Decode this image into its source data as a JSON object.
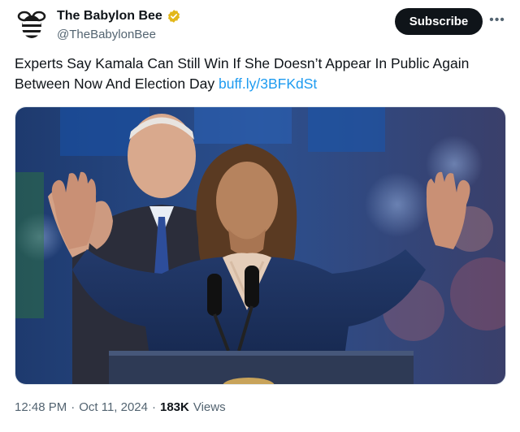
{
  "account": {
    "display_name": "The Babylon Bee",
    "handle": "@TheBabylonBee",
    "avatar_icon": "bee-logo-icon",
    "verified_icon": "gold-verified-badge-icon",
    "verified_color": "#e2b719"
  },
  "actions": {
    "subscribe_label": "Subscribe",
    "more_icon": "more-horizontal-icon"
  },
  "tweet": {
    "text": "Experts Say Kamala Can Still Win If She Doesn’t Appear In Public Again Between Now And Election Day",
    "link": "buff.ly/3BFKdSt",
    "link_color": "#1d9bf0"
  },
  "media": {
    "type": "photo"
  },
  "meta": {
    "time": "12:48 PM",
    "separator": "·",
    "date": "Oct 11, 2024",
    "views_count": "183K",
    "views_label": "Views"
  }
}
